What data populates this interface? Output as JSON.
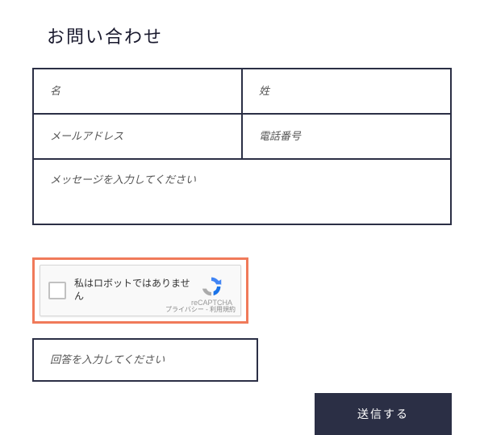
{
  "title": "お問い合わせ",
  "fields": {
    "first_name": {
      "placeholder": "名",
      "value": ""
    },
    "last_name": {
      "placeholder": "姓",
      "value": ""
    },
    "email": {
      "placeholder": "メールアドレス",
      "value": ""
    },
    "phone": {
      "placeholder": "電話番号",
      "value": ""
    },
    "message": {
      "placeholder": "メッセージを入力してください",
      "value": ""
    },
    "answer": {
      "placeholder": "回答を入力してください",
      "value": ""
    }
  },
  "captcha": {
    "label": "私はロボットではありません",
    "brand": "reCAPTCHA",
    "terms": "プライバシー - 利用規約"
  },
  "submit_label": "送信する",
  "colors": {
    "border": "#2b2f45",
    "highlight": "#f07a5a"
  }
}
